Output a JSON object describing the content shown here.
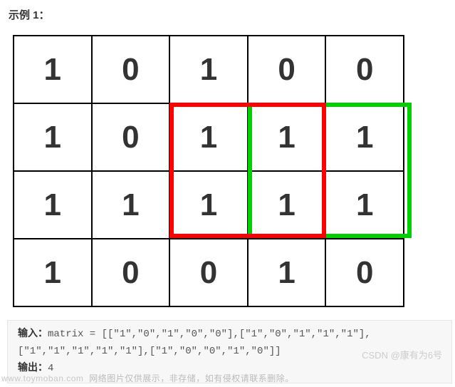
{
  "title": "示例 1：",
  "grid": [
    [
      "1",
      "0",
      "1",
      "0",
      "0"
    ],
    [
      "1",
      "0",
      "1",
      "1",
      "1"
    ],
    [
      "1",
      "1",
      "1",
      "1",
      "1"
    ],
    [
      "1",
      "0",
      "0",
      "1",
      "0"
    ]
  ],
  "code": {
    "input_label": "输入：",
    "input_text": "matrix = [[\"1\",\"0\",\"1\",\"0\",\"0\"],[\"1\",\"0\",\"1\",\"1\",\"1\"],",
    "input_text2": "[\"1\",\"1\",\"1\",\"1\",\"1\"],[\"1\",\"0\",\"0\",\"1\",\"0\"]]",
    "output_label": "输出：",
    "output_value": "4"
  },
  "watermark": {
    "left_site": "www.toymoban.com",
    "left_note": "网络图片仅供展示，非存储，如有侵权请联系删除。",
    "right": "CSDN @康有为6号"
  },
  "chart_data": {
    "type": "table",
    "title": "Binary matrix with highlighted maximal square submatrices",
    "rows": 4,
    "cols": 5,
    "cells": [
      [
        "1",
        "0",
        "1",
        "0",
        "0"
      ],
      [
        "1",
        "0",
        "1",
        "1",
        "1"
      ],
      [
        "1",
        "1",
        "1",
        "1",
        "1"
      ],
      [
        "1",
        "0",
        "0",
        "1",
        "0"
      ]
    ],
    "annotations": [
      {
        "name": "red-box",
        "row_start": 1,
        "row_end": 2,
        "col_start": 2,
        "col_end": 3,
        "color": "#ff0000"
      },
      {
        "name": "green-box",
        "row_start": 1,
        "row_end": 2,
        "col_start": 3,
        "col_end": 4,
        "color": "#00d000"
      }
    ],
    "answer": 4
  }
}
